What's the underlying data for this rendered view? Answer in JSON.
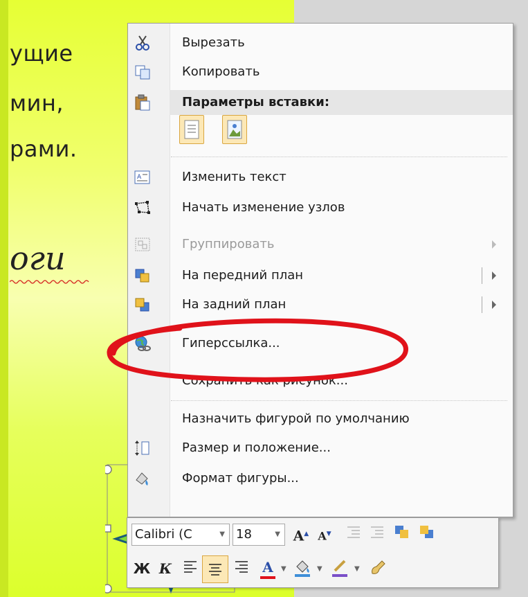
{
  "slide": {
    "lines": [
      "ущие",
      "мин,",
      "рами."
    ],
    "italic_text": "оги"
  },
  "context_menu": {
    "items": [
      {
        "label": "Вырезать",
        "icon": "scissors-icon"
      },
      {
        "label": "Копировать",
        "icon": "copy-icon"
      },
      {
        "label": "Параметры вставки:",
        "icon": "paste-icon"
      },
      {
        "label": "Изменить текст",
        "icon": "edit-text-icon"
      },
      {
        "label": "Начать изменение узлов",
        "icon": "edit-points-icon"
      },
      {
        "label": "Группировать",
        "icon": "group-icon",
        "disabled": true
      },
      {
        "label": "На передний план",
        "icon": "bring-forward-icon"
      },
      {
        "label": "На задний план",
        "icon": "send-backward-icon"
      },
      {
        "label": "Гиперссылка...",
        "icon": "hyperlink-icon"
      },
      {
        "label": "Сохранить как рисунок...",
        "icon": ""
      },
      {
        "label": "Назначить фигурой по умолчанию",
        "icon": ""
      },
      {
        "label": "Размер и положение...",
        "icon": "size-position-icon"
      },
      {
        "label": "Формат фигуры...",
        "icon": "format-shape-icon"
      }
    ],
    "paste_options": [
      "keep-text-only-icon",
      "picture-icon"
    ]
  },
  "mini_toolbar": {
    "font_name": "Calibri (С",
    "font_size": "18",
    "bold_label": "Ж",
    "italic_label": "К",
    "font_color_label": "A",
    "grow_font_label": "A",
    "shrink_font_label": "A"
  },
  "colors": {
    "annotation": "#e0121a",
    "highlight": "#fce8b6",
    "slide_bg": "#eaff4a"
  }
}
